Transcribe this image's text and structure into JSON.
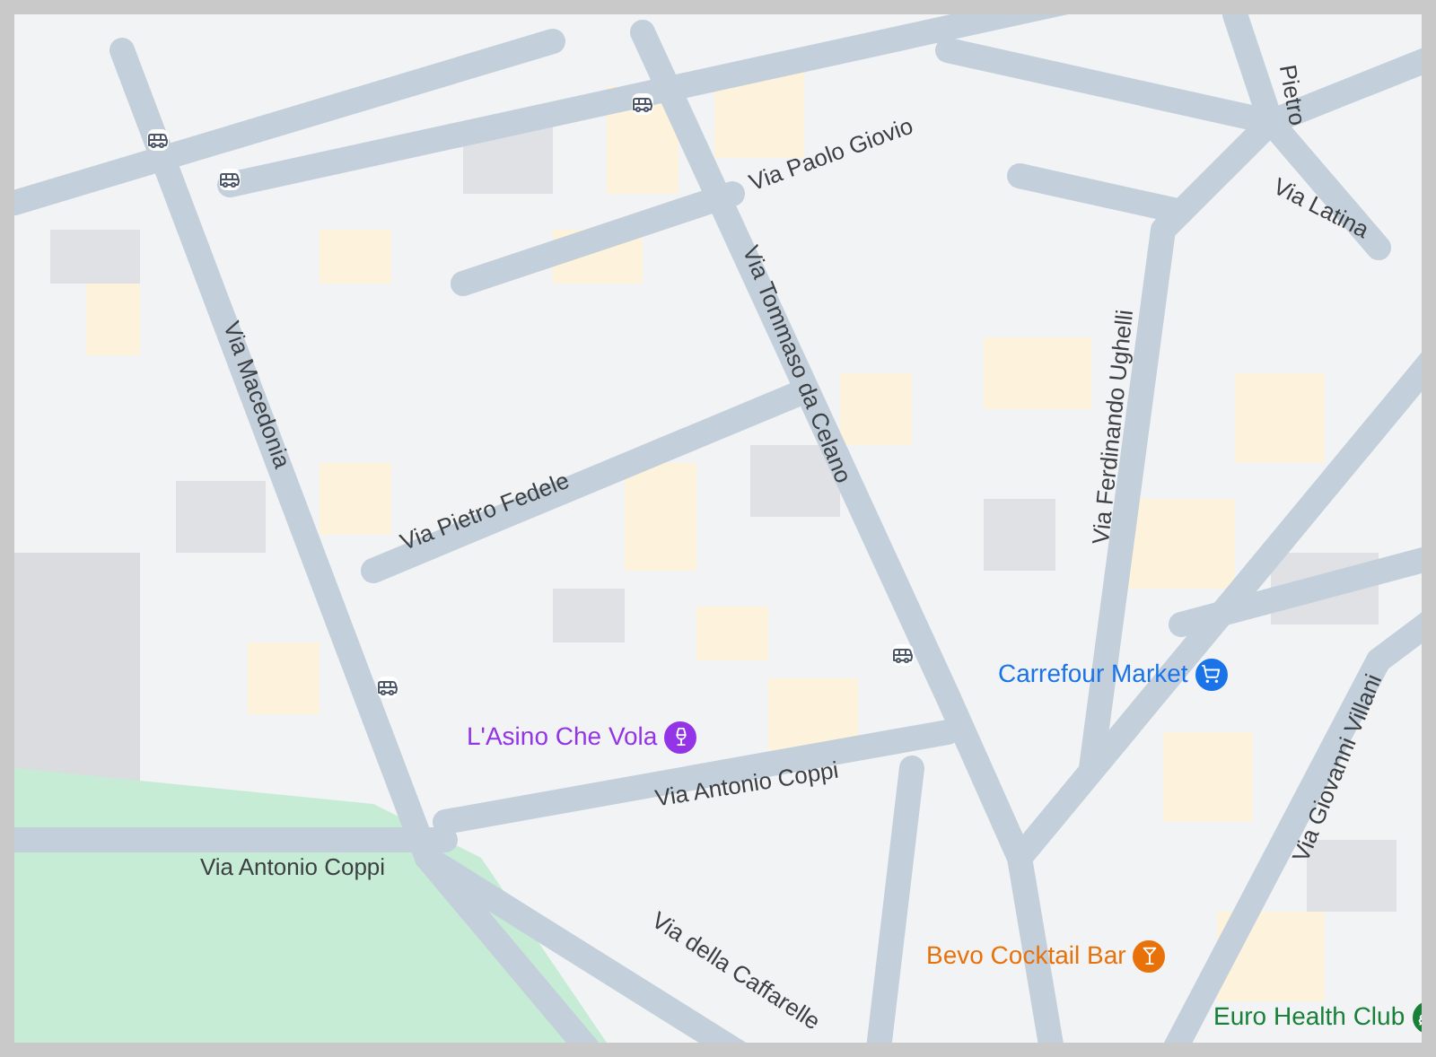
{
  "map": {
    "street_labels": [
      {
        "text": "Via Paolo Giovio"
      },
      {
        "text": "Pietro"
      },
      {
        "text": "Via Latina"
      },
      {
        "text": "Via Tommaso da Celano"
      },
      {
        "text": "Via Macedonia"
      },
      {
        "text": "Via Pietro Fedele"
      },
      {
        "text": "Via Ferdinando Ughelli"
      },
      {
        "text": "Via Antonio Coppi"
      },
      {
        "text": "Via Antonio Coppi"
      },
      {
        "text": "Via Giovanni Villani"
      },
      {
        "text": "Via della Caffarelle"
      }
    ],
    "places": [
      {
        "name": "Carrefour Market",
        "kind": "shop",
        "color": "#1a73e8"
      },
      {
        "name": "L'Asino Che Vola",
        "kind": "drinks",
        "color": "#9334e6"
      },
      {
        "name": "Bevo Cocktail Bar",
        "kind": "cocktail",
        "color": "#e8710a"
      },
      {
        "name": "Euro Health Club",
        "kind": "club",
        "color": "#188038"
      }
    ]
  }
}
